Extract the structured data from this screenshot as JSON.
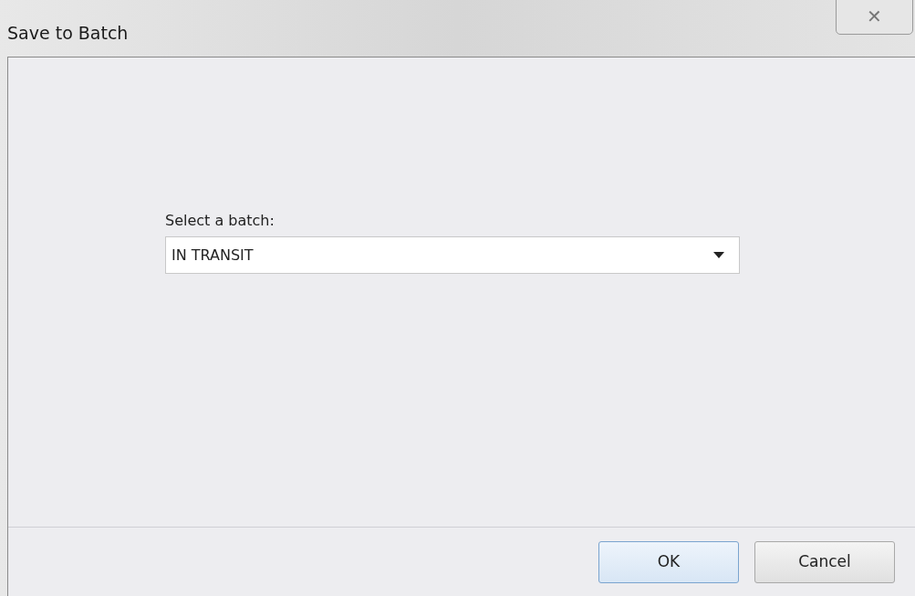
{
  "window": {
    "title": "Save to Batch",
    "close": "✕"
  },
  "batch": {
    "label": "Select a batch:",
    "value": "IN TRANSIT"
  },
  "buttons": [
    {
      "label": "OK",
      "default": true
    },
    {
      "label": "Cancel",
      "default": false
    }
  ]
}
